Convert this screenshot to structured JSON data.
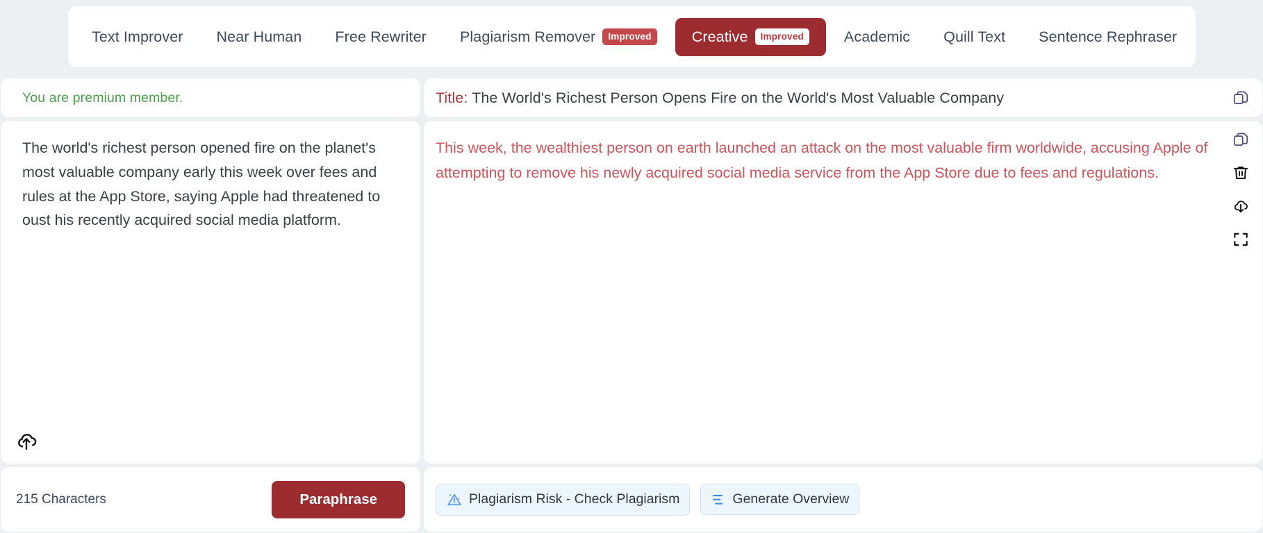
{
  "colors": {
    "page_bg": "#ecf0f3",
    "brand_red": "#9c2c2f",
    "badge_red": "#c3484b",
    "output_red": "#c9565c",
    "premium_green": "#4f9f4e",
    "chip_blue_bg": "#eef6fd",
    "chip_blue_border": "#cfe2f4"
  },
  "tabs": [
    {
      "label": "Text Improver",
      "badge": null,
      "active": false
    },
    {
      "label": "Near Human",
      "badge": null,
      "active": false
    },
    {
      "label": "Free Rewriter",
      "badge": null,
      "active": false
    },
    {
      "label": "Plagiarism Remover",
      "badge": "Improved",
      "active": false
    },
    {
      "label": "Creative",
      "badge": "Improved",
      "active": true
    },
    {
      "label": "Academic",
      "badge": null,
      "active": false
    },
    {
      "label": "Quill Text",
      "badge": null,
      "active": false
    },
    {
      "label": "Sentence Rephraser",
      "badge": null,
      "active": false
    }
  ],
  "left": {
    "premium_notice": "You are premium member.",
    "input_text": "The world's richest person opened fire on the planet's most valuable company early this week over fees and rules at the App Store, saying Apple had threatened to oust his recently acquired social media platform.",
    "upload_icon": "cloud-upload-icon",
    "char_count": "215 Characters",
    "paraphrase_label": "Paraphrase"
  },
  "right": {
    "title_label": "Title:",
    "title_value": "The World's Richest Person Opens Fire on the World's Most Valuable Company",
    "output_text": "This week, the wealthiest person on earth launched an attack on the most valuable firm worldwide, accusing Apple of attempting to remove his newly acquired social media service from the App Store due to fees and regulations.",
    "header_icon": "copy-icon",
    "rail_icons": [
      "copy-icon",
      "trash-icon",
      "cloud-download-icon",
      "fullscreen-icon"
    ],
    "chips": [
      {
        "icon": "warning-triangle-icon",
        "label": "Plagiarism Risk - Check Plagiarism"
      },
      {
        "icon": "list-bars-icon",
        "label": "Generate Overview"
      }
    ]
  }
}
